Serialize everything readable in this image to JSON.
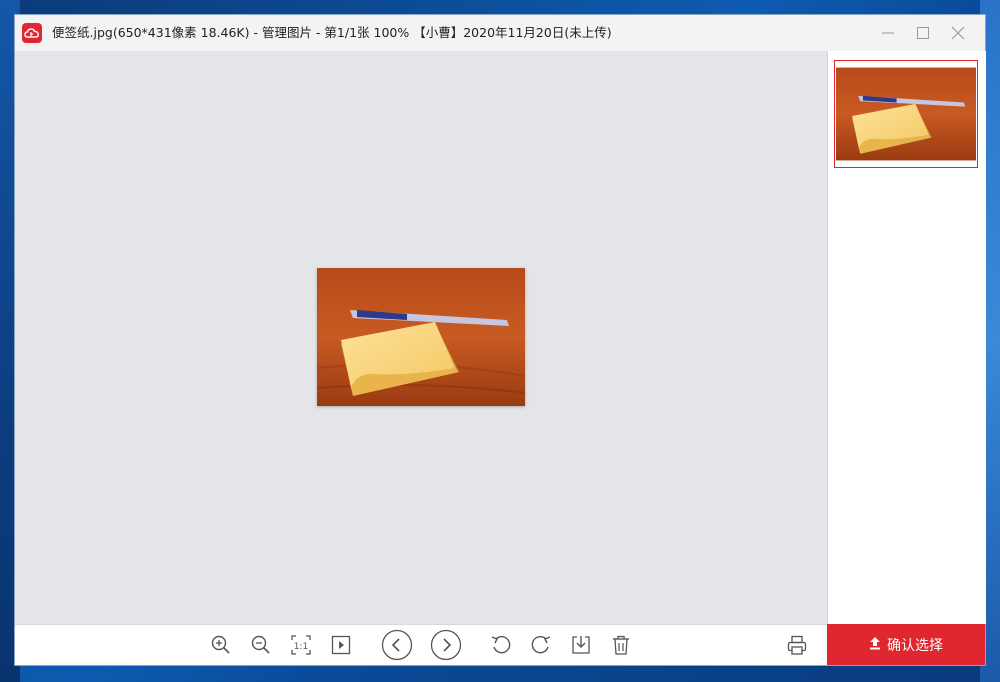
{
  "window": {
    "title": "便签纸.jpg(650*431像素 18.46K) - 管理图片 - 第1/1张 100% 【小曹】2020年11月20日(未上传)"
  },
  "icons": {
    "app": "cloud-logo-icon",
    "minimize": "minimize-icon",
    "maximize": "maximize-icon",
    "close": "close-icon",
    "toolbar": [
      "zoom-in-icon",
      "zoom-out-icon",
      "actual-size-icon",
      "slideshow-icon",
      "previous-icon",
      "next-icon",
      "rotate-left-icon",
      "rotate-right-icon",
      "save-download-icon",
      "delete-icon",
      "print-icon"
    ],
    "upload": "upload-arrow-icon"
  },
  "toolbar": {
    "actual_size_label": "1:1"
  },
  "sidebar": {
    "confirm_label": "确认选择"
  },
  "colors": {
    "accent": "#e0262e",
    "viewer_bg": "#e4e5e9"
  }
}
